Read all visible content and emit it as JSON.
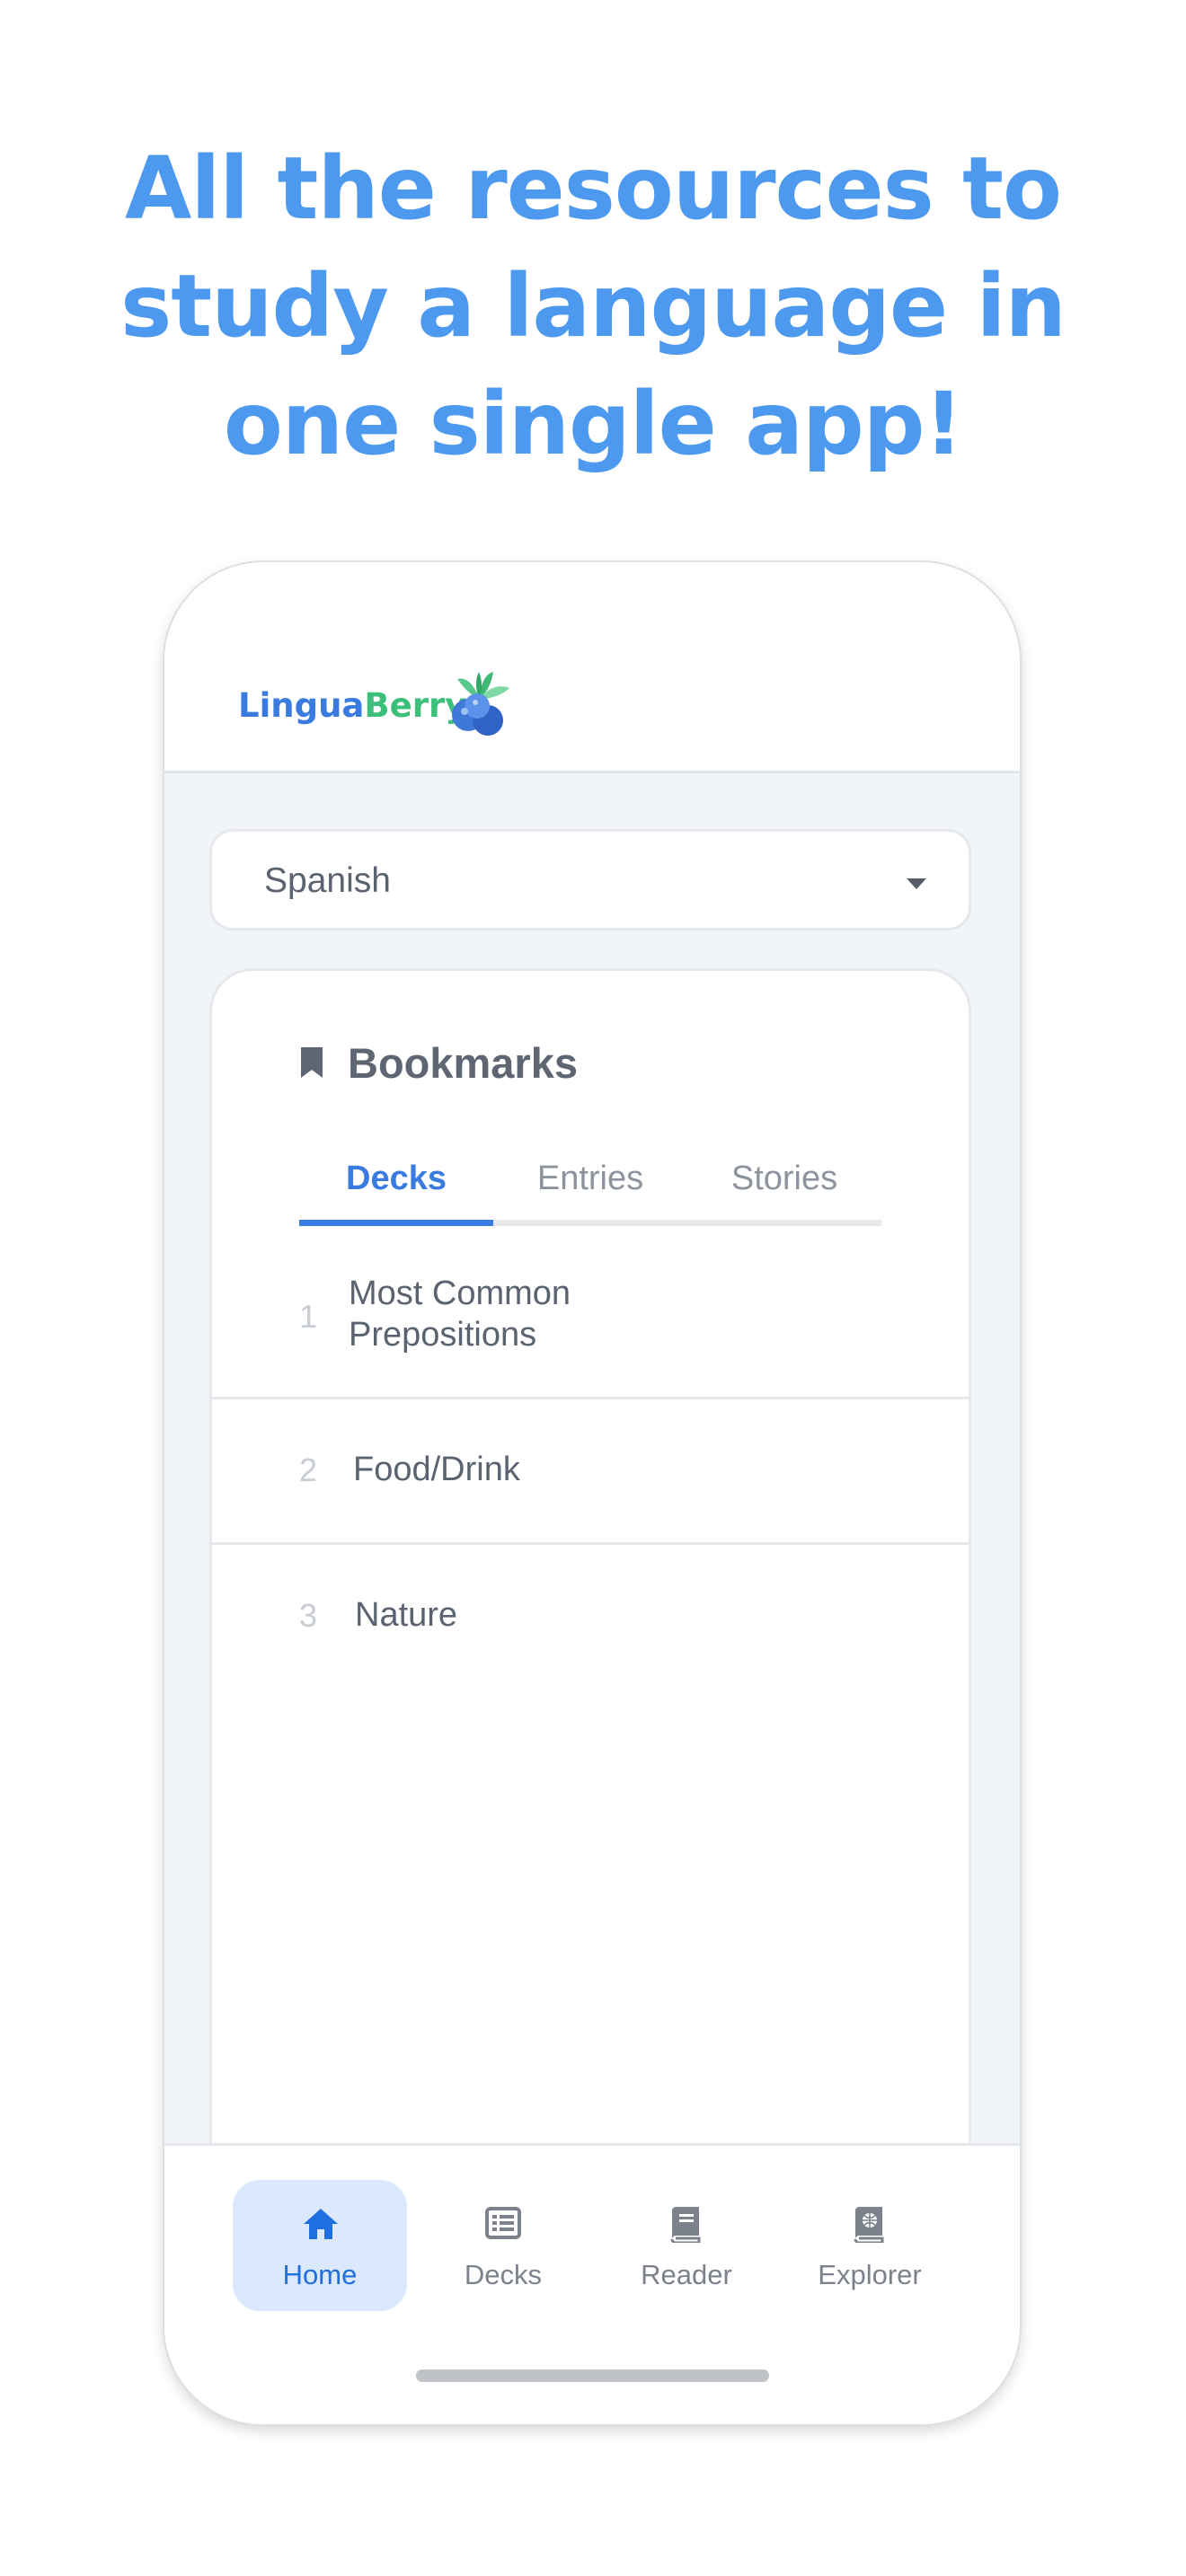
{
  "headline": {
    "line1": "All the resources to",
    "line2": "study a language in",
    "line3": "one single app!",
    "color": "#4d99f0"
  },
  "app": {
    "brand": {
      "part1": "Lingua",
      "part2": "Berry",
      "logo_icon": "blueberry-icon"
    },
    "language_select": {
      "value": "Spanish",
      "icon": "caret-down-icon"
    },
    "bookmarks": {
      "title": "Bookmarks",
      "icon": "bookmark-icon",
      "tabs": [
        {
          "label": "Decks",
          "active": true
        },
        {
          "label": "Entries",
          "active": false
        },
        {
          "label": "Stories",
          "active": false
        }
      ],
      "items": [
        {
          "num": "1",
          "label_line1": "Most Common",
          "label_line2": "Prepositions"
        },
        {
          "num": "2",
          "label_line1": "Food/Drink"
        },
        {
          "num": "3",
          "label_line1": "Nature"
        }
      ]
    },
    "bottom_nav": [
      {
        "label": "Home",
        "icon": "home-icon",
        "active": true
      },
      {
        "label": "Decks",
        "icon": "list-icon",
        "active": false
      },
      {
        "label": "Reader",
        "icon": "book-icon",
        "active": false
      },
      {
        "label": "Explorer",
        "icon": "globe-book-icon",
        "active": false
      }
    ]
  },
  "colors": {
    "accent": "#3a7be0",
    "brand_green": "#3cbf7a",
    "background": "#f1f4f8"
  }
}
